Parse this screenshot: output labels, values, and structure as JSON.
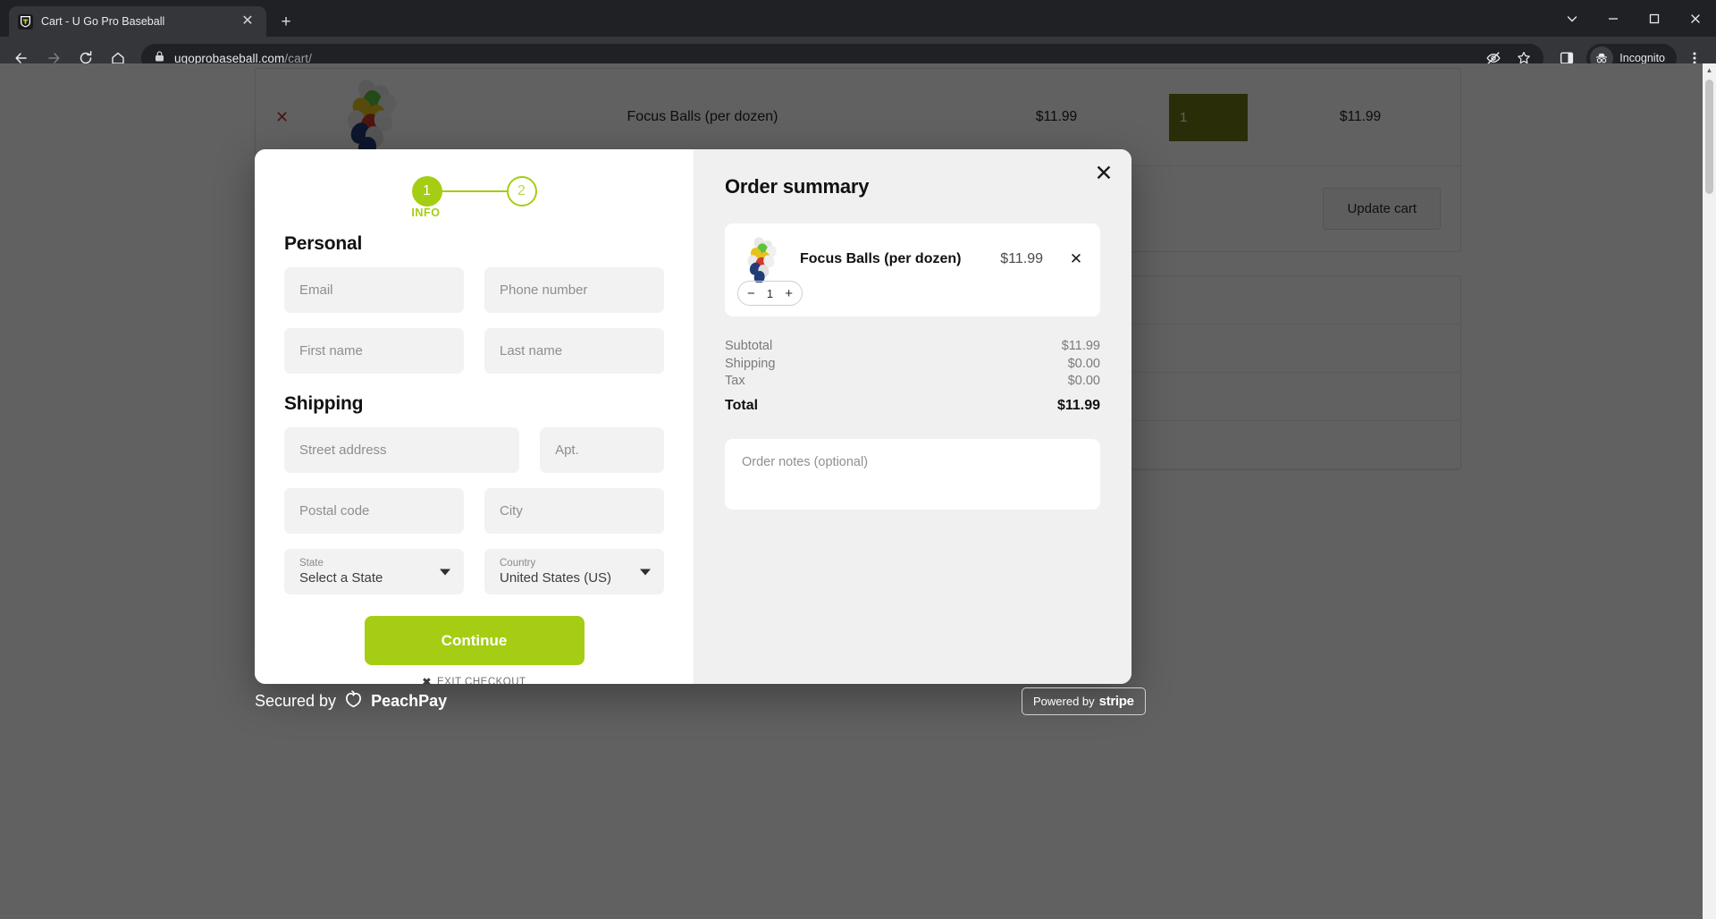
{
  "browser": {
    "tab": {
      "title": "Cart - U Go Pro Baseball",
      "close_icon": "close-icon",
      "favicon": "site-favicon"
    },
    "new_tab_label": "+",
    "window": {
      "minimize": "–",
      "maximize": "❐",
      "close": "✕",
      "tab_search": "⌄"
    },
    "nav": {
      "back": "←",
      "forward": "→",
      "reload": "⟳",
      "home": "⌂"
    },
    "omnibox": {
      "lock_icon": "lock-icon",
      "url_host": "ugoprobaseball.com",
      "url_path": "/cart/",
      "tracking_protection_icon": "eye-slash-icon",
      "bookmark_icon": "star-icon",
      "side_panel_icon": "side-panel-icon",
      "profile_label": "Incognito",
      "menu_icon": "three-dot-menu-icon"
    }
  },
  "cart_page": {
    "remove_icon": "✕",
    "product_name": "Focus Balls (per dozen)",
    "price": "$11.99",
    "quantity": "1",
    "line_total": "$11.99",
    "update_cart_label": "Update cart"
  },
  "modal": {
    "close_label": "✕",
    "steps": [
      {
        "number": "1",
        "label": "INFO",
        "state": "active"
      },
      {
        "number": "2",
        "label": "",
        "state": "inactive"
      }
    ],
    "personal": {
      "heading": "Personal",
      "email_placeholder": "Email",
      "phone_placeholder": "Phone number",
      "first_name_placeholder": "First name",
      "last_name_placeholder": "Last name"
    },
    "shipping": {
      "heading": "Shipping",
      "street_placeholder": "Street address",
      "apt_placeholder": "Apt.",
      "postal_placeholder": "Postal code",
      "city_placeholder": "City",
      "state_label": "State",
      "state_value": "Select a State",
      "country_label": "Country",
      "country_value": "United States (US)"
    },
    "continue_label": "Continue",
    "exit_label": "EXIT CHECKOUT",
    "exit_icon": "✖",
    "summary": {
      "heading": "Order summary",
      "item": {
        "name": "Focus Balls (per dozen)",
        "price": "$11.99",
        "remove_icon": "✕",
        "quantity": "1",
        "decrement": "−",
        "increment": "+"
      },
      "lines": [
        {
          "label": "Subtotal",
          "value": "$11.99"
        },
        {
          "label": "Shipping",
          "value": "$0.00"
        },
        {
          "label": "Tax",
          "value": "$0.00"
        }
      ],
      "total_label": "Total",
      "total_value": "$11.99",
      "notes_placeholder": "Order notes (optional)"
    }
  },
  "footer": {
    "secured_prefix": "Secured by",
    "secured_brand": "PeachPay",
    "stripe_prefix": "Powered by",
    "stripe_brand": "stripe"
  },
  "colors": {
    "accent_green": "#a5cd13",
    "qty_green": "#6c7a16",
    "chrome_dark": "#202124",
    "toolbar": "#35363a",
    "panel_gray": "#f0f0f0"
  }
}
